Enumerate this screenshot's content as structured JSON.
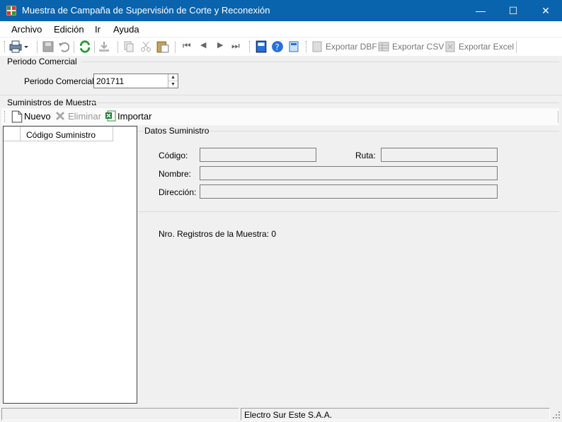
{
  "window": {
    "title": "Muestra de Campaña de Supervisión de Corte y Reconexión",
    "minimize": "—",
    "maximize": "☐",
    "close": "✕"
  },
  "menu": [
    "Archivo",
    "Edición",
    "Ir",
    "Ayuda"
  ],
  "toolbar": {
    "export_dbf": "Exportar DBF",
    "export_csv": "Exportar CSV",
    "export_excel": "Exportar Excel"
  },
  "periodo": {
    "group_label": "Periodo Comercial",
    "field_label": "Periodo Comercial:",
    "value": "201711"
  },
  "suministros": {
    "group_label": "Suministros de Muestra",
    "nuevo": "Nuevo",
    "eliminar": "Eliminar",
    "importar": "Importar",
    "column": "Código Suministro"
  },
  "datos": {
    "title": "Datos Suministro",
    "codigo_label": "Código:",
    "ruta_label": "Ruta:",
    "nombre_label": "Nombre:",
    "direccion_label": "Dirección:",
    "codigo_value": "",
    "ruta_value": "",
    "nombre_value": "",
    "direccion_value": ""
  },
  "registros": "Nro. Registros de la Muestra: 0",
  "status": {
    "panel1": "",
    "panel2": "Electro Sur Este S.A.A."
  },
  "colors": {
    "titlebar": "#0a64ad",
    "accent_blue": "#2c6fd6",
    "green": "#2a9a3a"
  }
}
